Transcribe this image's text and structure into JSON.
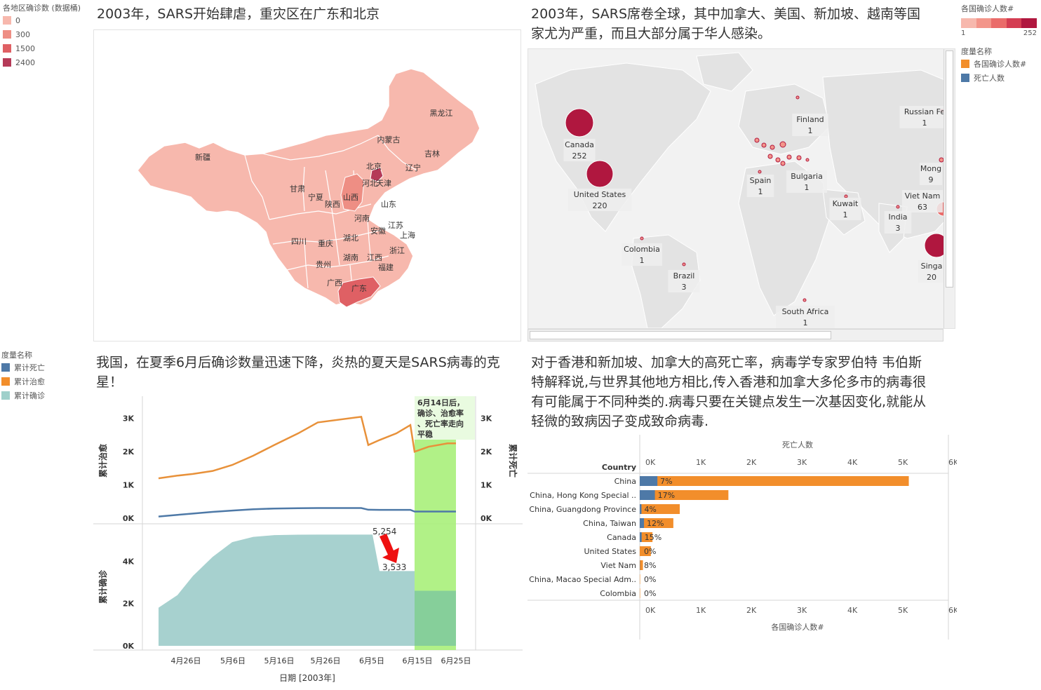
{
  "china_map": {
    "title": "2003年，SARS开始肆虐，重灾区在广东和北京",
    "legend_title": "各地区确诊数 (数据桶)",
    "legend": [
      {
        "label": "0",
        "color": "#f7b8ad"
      },
      {
        "label": "300",
        "color": "#ee8e84"
      },
      {
        "label": "1500",
        "color": "#df6064"
      },
      {
        "label": "2400",
        "color": "#b53a58"
      }
    ],
    "provinces": [
      "新疆",
      "内蒙古",
      "黑龙江",
      "吉林",
      "辽宁",
      "北京",
      "天津",
      "河北",
      "山西",
      "甘肃",
      "宁夏",
      "陕西",
      "山东",
      "河南",
      "江苏",
      "安徽",
      "上海",
      "四川",
      "重庆",
      "湖北",
      "浙江",
      "湖南",
      "江西",
      "贵州",
      "福建",
      "广西",
      "广东"
    ]
  },
  "world_map": {
    "title_line1": "2003年，SARS席卷全球，其中加拿大、美国、新加坡、越南等国",
    "title_line2": "家尤为严重，而且大部分属于华人感染。",
    "legend_title": "各国确诊人数#",
    "legend_min": "1",
    "legend_max": "252",
    "measure_title": "度量名称",
    "measures": [
      {
        "label": "各国确诊人数#",
        "color": "#f28e2b"
      },
      {
        "label": "死亡人数",
        "color": "#4e79a7"
      }
    ],
    "countries": [
      {
        "name": "Canada",
        "value": "252"
      },
      {
        "name": "United States",
        "value": "220"
      },
      {
        "name": "Finland",
        "value": "1"
      },
      {
        "name": "Russian Fe",
        "value": "1"
      },
      {
        "name": "Spain",
        "value": "1"
      },
      {
        "name": "Bulgaria",
        "value": "1"
      },
      {
        "name": "Kuwait",
        "value": "1"
      },
      {
        "name": "Mong",
        "value": "9"
      },
      {
        "name": "Viet Nam",
        "value": "63"
      },
      {
        "name": "India",
        "value": "3"
      },
      {
        "name": "Colombia",
        "value": "1"
      },
      {
        "name": "Brazil",
        "value": "3"
      },
      {
        "name": "Singa",
        "value": "20"
      },
      {
        "name": "South Africa",
        "value": "1"
      }
    ]
  },
  "trend": {
    "title_line1": "我国，在夏季6月后确诊数量迅速下降，炎热的夏天是SARS病毒的克",
    "title_line2": "星！",
    "measure_title": "度量名称",
    "measures": [
      {
        "label": "累计死亡",
        "color": "#4e79a7"
      },
      {
        "label": "累计治愈",
        "color": "#f28e2b"
      },
      {
        "label": "累计确诊",
        "color": "#9fd0cb"
      }
    ],
    "upper_left_axis_label": "累计治愈",
    "upper_right_axis_label": "累计死亡",
    "lower_axis_label": "累计确诊",
    "upper_ticks": [
      "3K",
      "2K",
      "1K",
      "0K"
    ],
    "upper_right_ticks": [
      "3K",
      "2K",
      "1K",
      "0K"
    ],
    "lower_ticks": [
      "4K",
      "2K",
      "0K"
    ],
    "x_ticks": [
      "4月26日",
      "5月6日",
      "5月16日",
      "5月26日",
      "6月5日",
      "6月15日",
      "6月25日"
    ],
    "x_title": "日期 [2003年]",
    "annotation": "6月14日后，确诊、治愈率、死亡率走向平稳",
    "annotation_lines": [
      "6月14日后，",
      "确诊、治愈率",
      "、死亡率走向",
      "平稳"
    ],
    "drop_from": "5,254",
    "drop_to": "3,533"
  },
  "bar": {
    "title_lines": [
      "对于香港和新加坡、加拿大的高死亡率，病毒学专家罗伯特 韦伯斯",
      "特解释说,与世界其他地方相比,传入香港和加拿大多伦多市的病毒很",
      "有可能属于不同种类的.病毒只要在关键点发生一次基因变化,就能从",
      "轻微的致病因子变成致命病毒."
    ],
    "top_axis_title": "死亡人数",
    "bottom_axis_title": "各国确诊人数#",
    "row_header": "Country",
    "ticks": [
      "0K",
      "1K",
      "2K",
      "3K",
      "4K",
      "5K",
      "6K"
    ]
  },
  "chart_data": [
    {
      "type": "bar",
      "title": "",
      "xlabel": "各国确诊人数#",
      "x2label": "死亡人数",
      "ylabel": "Country",
      "xlim": [
        0,
        6000
      ],
      "categories": [
        "China",
        "China, Hong Kong Special ..",
        "China, Guangdong Province",
        "China, Taiwan",
        "Canada",
        "United States",
        "Viet Nam",
        "China, Macao Special Adm..",
        "Colombia"
      ],
      "series": [
        {
          "name": "各国确诊人数#",
          "values": [
            5327,
            1755,
            792,
            665,
            252,
            220,
            63,
            1,
            1
          ]
        },
        {
          "name": "死亡人数",
          "values": [
            349,
            300,
            34,
            84,
            38,
            0,
            5,
            0,
            0
          ]
        }
      ],
      "data_labels": [
        "7%",
        "17%",
        "4%",
        "12%",
        "15%",
        "0%",
        "8%",
        "0%",
        "0%"
      ]
    },
    {
      "type": "line",
      "title": "",
      "xlabel": "日期 [2003年]",
      "ylabel": "累计治愈",
      "y2label": "累计死亡",
      "ylim": [
        0,
        3500
      ],
      "x": [
        "4月21日",
        "4月26日",
        "5月1日",
        "5月6日",
        "5月11日",
        "5月16日",
        "5月21日",
        "5月26日",
        "5月31日",
        "6月3日",
        "6月5日",
        "6月8日",
        "6月11日",
        "6月14日",
        "6月15日",
        "6月20日",
        "6月25日",
        "6月26日"
      ],
      "series": [
        {
          "name": "累计治愈",
          "values": [
            1200,
            1280,
            1330,
            1420,
            1600,
            1880,
            2200,
            2550,
            2880,
            3050,
            2200,
            2350,
            2550,
            2800,
            2000,
            2150,
            2250,
            2250
          ]
        },
        {
          "name": "累计死亡",
          "values": [
            50,
            100,
            140,
            190,
            230,
            270,
            290,
            300,
            305,
            305,
            255,
            250,
            250,
            250,
            200,
            200,
            200,
            200
          ]
        }
      ]
    },
    {
      "type": "area",
      "title": "",
      "xlabel": "日期 [2003年]",
      "ylabel": "累计确诊",
      "ylim": [
        0,
        5500
      ],
      "x": [
        "4月21日",
        "4月26日",
        "5月1日",
        "5月6日",
        "5月11日",
        "5月16日",
        "5月21日",
        "5月26日",
        "5月31日",
        "6月5日",
        "6月8日",
        "6月14日",
        "6月15日",
        "6月25日"
      ],
      "series": [
        {
          "name": "累计确诊",
          "values": [
            1800,
            2400,
            3300,
            4200,
            4900,
            5150,
            5230,
            5250,
            5254,
            5254,
            3533,
            3533,
            2600,
            2600
          ]
        }
      ]
    }
  ]
}
